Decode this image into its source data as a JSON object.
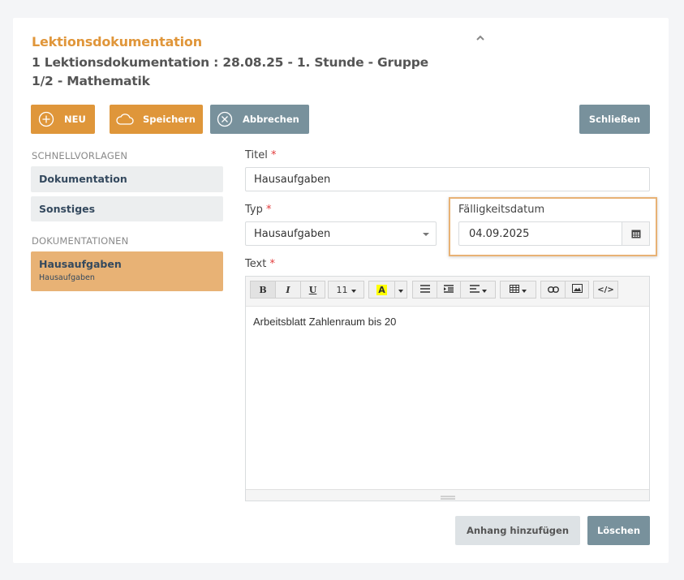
{
  "header": {
    "title": "Lektionsdokumentation",
    "subtitle": "1 Lektionsdokumentation : 28.08.25 - 1. Stunde - Gruppe 1/2 - Mathematik"
  },
  "toolbar": {
    "new_label": "NEU",
    "save_label": "Speichern",
    "cancel_label": "Abbrechen",
    "close_label": "Schließen"
  },
  "sidebar": {
    "templates_heading": "SCHNELLVORLAGEN",
    "templates": [
      {
        "label": "Dokumentation"
      },
      {
        "label": "Sonstiges"
      }
    ],
    "docs_heading": "DOKUMENTATIONEN",
    "docs": [
      {
        "label": "Hausaufgaben",
        "sub": "Hausaufgaben"
      }
    ]
  },
  "form": {
    "title_label": "Titel",
    "title_value": "Hausaufgaben",
    "type_label": "Typ",
    "type_value": "Hausaufgaben",
    "due_label": "Fälligkeitsdatum",
    "due_value": "04.09.2025",
    "text_label": "Text",
    "required_mark": "*",
    "font_size": "11",
    "text_content": "Arbeitsblatt Zahlenraum bis 20"
  },
  "footer": {
    "attach_label": "Anhang hinzufügen",
    "delete_label": "Löschen"
  },
  "colors": {
    "accent": "#df963a",
    "active_item": "#e8b275",
    "gray_button": "#78919c"
  }
}
